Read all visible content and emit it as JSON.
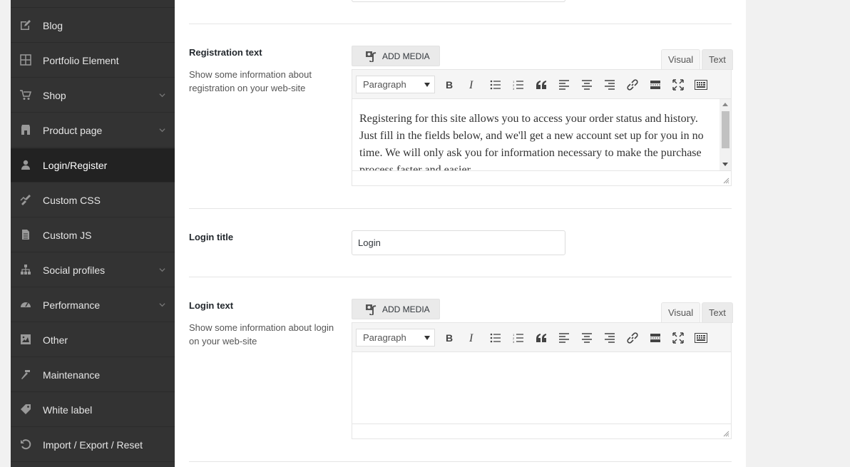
{
  "sidebar": {
    "items": [
      {
        "label": "Blog",
        "icon": "edit-icon",
        "has_submenu": false
      },
      {
        "label": "Portfolio Element",
        "icon": "grid-icon",
        "has_submenu": false
      },
      {
        "label": "Shop",
        "icon": "cart-icon",
        "has_submenu": true
      },
      {
        "label": "Product page",
        "icon": "store-icon",
        "has_submenu": true
      },
      {
        "label": "Login/Register",
        "icon": "user-icon",
        "has_submenu": false,
        "active": true
      },
      {
        "label": "Custom CSS",
        "icon": "brush-icon",
        "has_submenu": false
      },
      {
        "label": "Custom JS",
        "icon": "document-icon",
        "has_submenu": false
      },
      {
        "label": "Social profiles",
        "icon": "network-icon",
        "has_submenu": true
      },
      {
        "label": "Performance",
        "icon": "dashboard-icon",
        "has_submenu": true
      },
      {
        "label": "Other",
        "icon": "image-filter-icon",
        "has_submenu": false
      },
      {
        "label": "Maintenance",
        "icon": "hammer-icon",
        "has_submenu": false
      },
      {
        "label": "White label",
        "icon": "tag-icon",
        "has_submenu": false
      },
      {
        "label": "Import / Export / Reset",
        "icon": "undo-icon",
        "has_submenu": false
      }
    ]
  },
  "fields": {
    "registration": {
      "title": "Registration text",
      "description": "Show some information about registration on your web-site",
      "content": "Registering for this site allows you to access your order status and history. Just fill in the fields below, and we'll get a new account set up for you in no time. We will only ask you for information necessary to make the purchase process faster and easier."
    },
    "login_title": {
      "title": "Login title",
      "value": "Login"
    },
    "login_text": {
      "title": "Login text",
      "description": "Show some information about login on your web-site",
      "content": ""
    }
  },
  "editor": {
    "add_media_label": "ADD MEDIA",
    "tab_visual": "Visual",
    "tab_text": "Text",
    "format_value": "Paragraph"
  },
  "colors": {
    "sidebar_bg": "#333333",
    "sidebar_active_bg": "#222222",
    "page_bg": "#f1f1f1"
  }
}
